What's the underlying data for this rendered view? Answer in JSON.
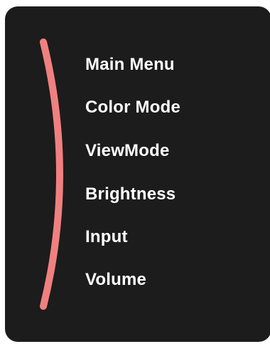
{
  "osd": {
    "accent_color": "#f08080",
    "background_color": "#1c1c1c",
    "items": [
      {
        "label": "Main Menu"
      },
      {
        "label": "Color Mode"
      },
      {
        "label": "ViewMode"
      },
      {
        "label": "Brightness"
      },
      {
        "label": "Input"
      },
      {
        "label": "Volume"
      }
    ]
  }
}
